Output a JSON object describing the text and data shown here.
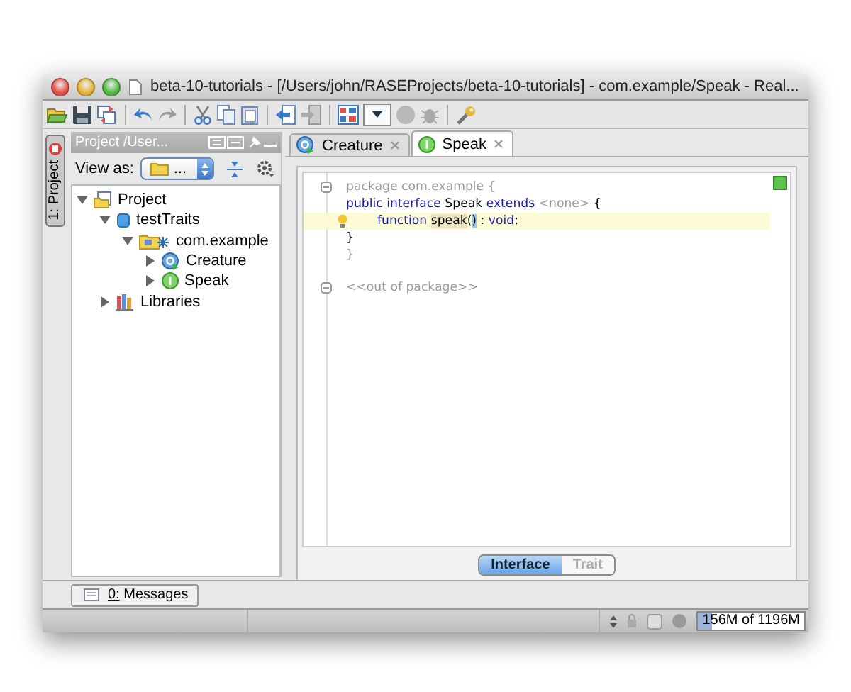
{
  "window": {
    "title": "beta-10-tutorials - [/Users/john/RASEProjects/beta-10-tutorials] - com.example/Speak - Real..."
  },
  "tool_stripe": {
    "label": "1: Project",
    "selected": true
  },
  "project_panel": {
    "title": "Project /User...",
    "view_as_label": "View as:",
    "view_as_value": "...",
    "tree": [
      {
        "label": "Project",
        "kind": "project",
        "expanded": true,
        "children": [
          {
            "label": "testTraits",
            "kind": "module",
            "expanded": true,
            "children": [
              {
                "label": "com.example",
                "kind": "package",
                "expanded": true,
                "children": [
                  {
                    "label": "Creature",
                    "kind": "class",
                    "expanded": false
                  },
                  {
                    "label": "Speak",
                    "kind": "interface",
                    "expanded": false
                  }
                ]
              }
            ]
          },
          {
            "label": "Libraries",
            "kind": "libraries",
            "expanded": false
          }
        ]
      }
    ]
  },
  "editor": {
    "tabs": [
      {
        "label": "Creature",
        "kind": "class",
        "selected": false
      },
      {
        "label": "Speak",
        "kind": "interface",
        "selected": true
      }
    ],
    "lines": [
      {
        "fold_start": true,
        "segments": [
          {
            "text": "package com.example {",
            "kind": "muted"
          }
        ]
      },
      {
        "segments": [
          {
            "text": "public interface",
            "kind": "keyword"
          },
          {
            "text": " Speak ",
            "kind": "plain"
          },
          {
            "text": "extends",
            "kind": "keyword"
          },
          {
            "text": " <none>",
            "kind": "muted"
          },
          {
            "text": " {",
            "kind": "plain"
          }
        ]
      },
      {
        "highlighted": true,
        "bulb": true,
        "indented": true,
        "segments": [
          {
            "text": "function ",
            "kind": "keyword"
          },
          {
            "text": "speak",
            "kind": "usage"
          },
          {
            "text": "(",
            "kind": "plain"
          },
          {
            "text": ")",
            "kind": "brace-match"
          },
          {
            "text": " : ",
            "kind": "plain"
          },
          {
            "text": "void",
            "kind": "keyword"
          },
          {
            "text": ";",
            "kind": "plain"
          }
        ]
      },
      {
        "segments": [
          {
            "text": "}",
            "kind": "plain"
          }
        ]
      },
      {
        "segments": [
          {
            "text": "}",
            "kind": "muted"
          }
        ]
      },
      {
        "fold_end": true,
        "gap_before": true,
        "segments": [
          {
            "text": "<<out of package>>",
            "kind": "muted"
          }
        ]
      }
    ],
    "mode_switch": [
      {
        "label": "Interface",
        "selected": true
      },
      {
        "label": "Trait",
        "selected": false
      }
    ]
  },
  "bottom_tool": {
    "label": "0: Messages"
  },
  "status_bar": {
    "memory": {
      "reading": "156M of 1196M",
      "level": 0.13
    }
  }
}
